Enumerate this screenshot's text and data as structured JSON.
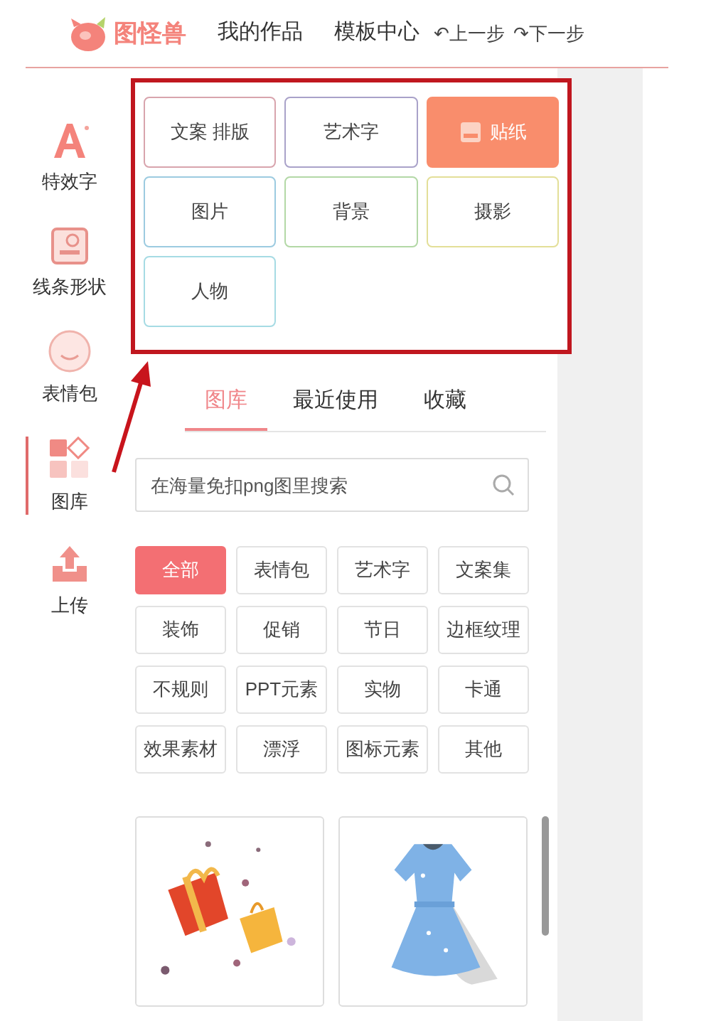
{
  "header": {
    "logo_text": "图怪兽",
    "nav": [
      "我的作品",
      "模板中心"
    ],
    "undo": {
      "icon": "↶",
      "label": "上一步"
    },
    "redo": {
      "icon": "↷",
      "label": "下一步"
    }
  },
  "sidebar": {
    "items": [
      {
        "label": "特效字",
        "kind": "text",
        "selected": false
      },
      {
        "label": "线条形状",
        "kind": "shape",
        "selected": false
      },
      {
        "label": "表情包",
        "kind": "emoji",
        "selected": false
      },
      {
        "label": "图库",
        "kind": "gallery",
        "selected": true
      },
      {
        "label": "上传",
        "kind": "upload",
        "selected": false
      }
    ]
  },
  "categories": [
    {
      "label": "文案 排版",
      "color": "#d8a4ad",
      "selected": false
    },
    {
      "label": "艺术字",
      "color": "#a9a2c9",
      "selected": false
    },
    {
      "label": "贴纸",
      "color": "#f98d6c",
      "selected": true
    },
    {
      "label": "图片",
      "color": "#9ccbe0",
      "selected": false
    },
    {
      "label": "背景",
      "color": "#b3d8a6",
      "selected": false
    },
    {
      "label": "摄影",
      "color": "#e3df98",
      "selected": false
    },
    {
      "label": "人物",
      "color": "#a6dbe4",
      "selected": false
    }
  ],
  "tabs": [
    {
      "label": "图库",
      "selected": true
    },
    {
      "label": "最近使用",
      "selected": false
    },
    {
      "label": "收藏",
      "selected": false
    }
  ],
  "search": {
    "placeholder": "在海量免扣png图里搜索"
  },
  "tags": [
    {
      "label": "全部",
      "selected": true
    },
    {
      "label": "表情包",
      "selected": false
    },
    {
      "label": "艺术字",
      "selected": false
    },
    {
      "label": "文案集",
      "selected": false
    },
    {
      "label": "装饰",
      "selected": false
    },
    {
      "label": "促销",
      "selected": false
    },
    {
      "label": "节日",
      "selected": false
    },
    {
      "label": "边框纹理",
      "selected": false
    },
    {
      "label": "不规则",
      "selected": false
    },
    {
      "label": "PPT元素",
      "selected": false
    },
    {
      "label": "实物",
      "selected": false
    },
    {
      "label": "卡通",
      "selected": false
    },
    {
      "label": "效果素材",
      "selected": false
    },
    {
      "label": "漂浮",
      "selected": false
    },
    {
      "label": "图标元素",
      "selected": false
    },
    {
      "label": "其他",
      "selected": false
    }
  ]
}
